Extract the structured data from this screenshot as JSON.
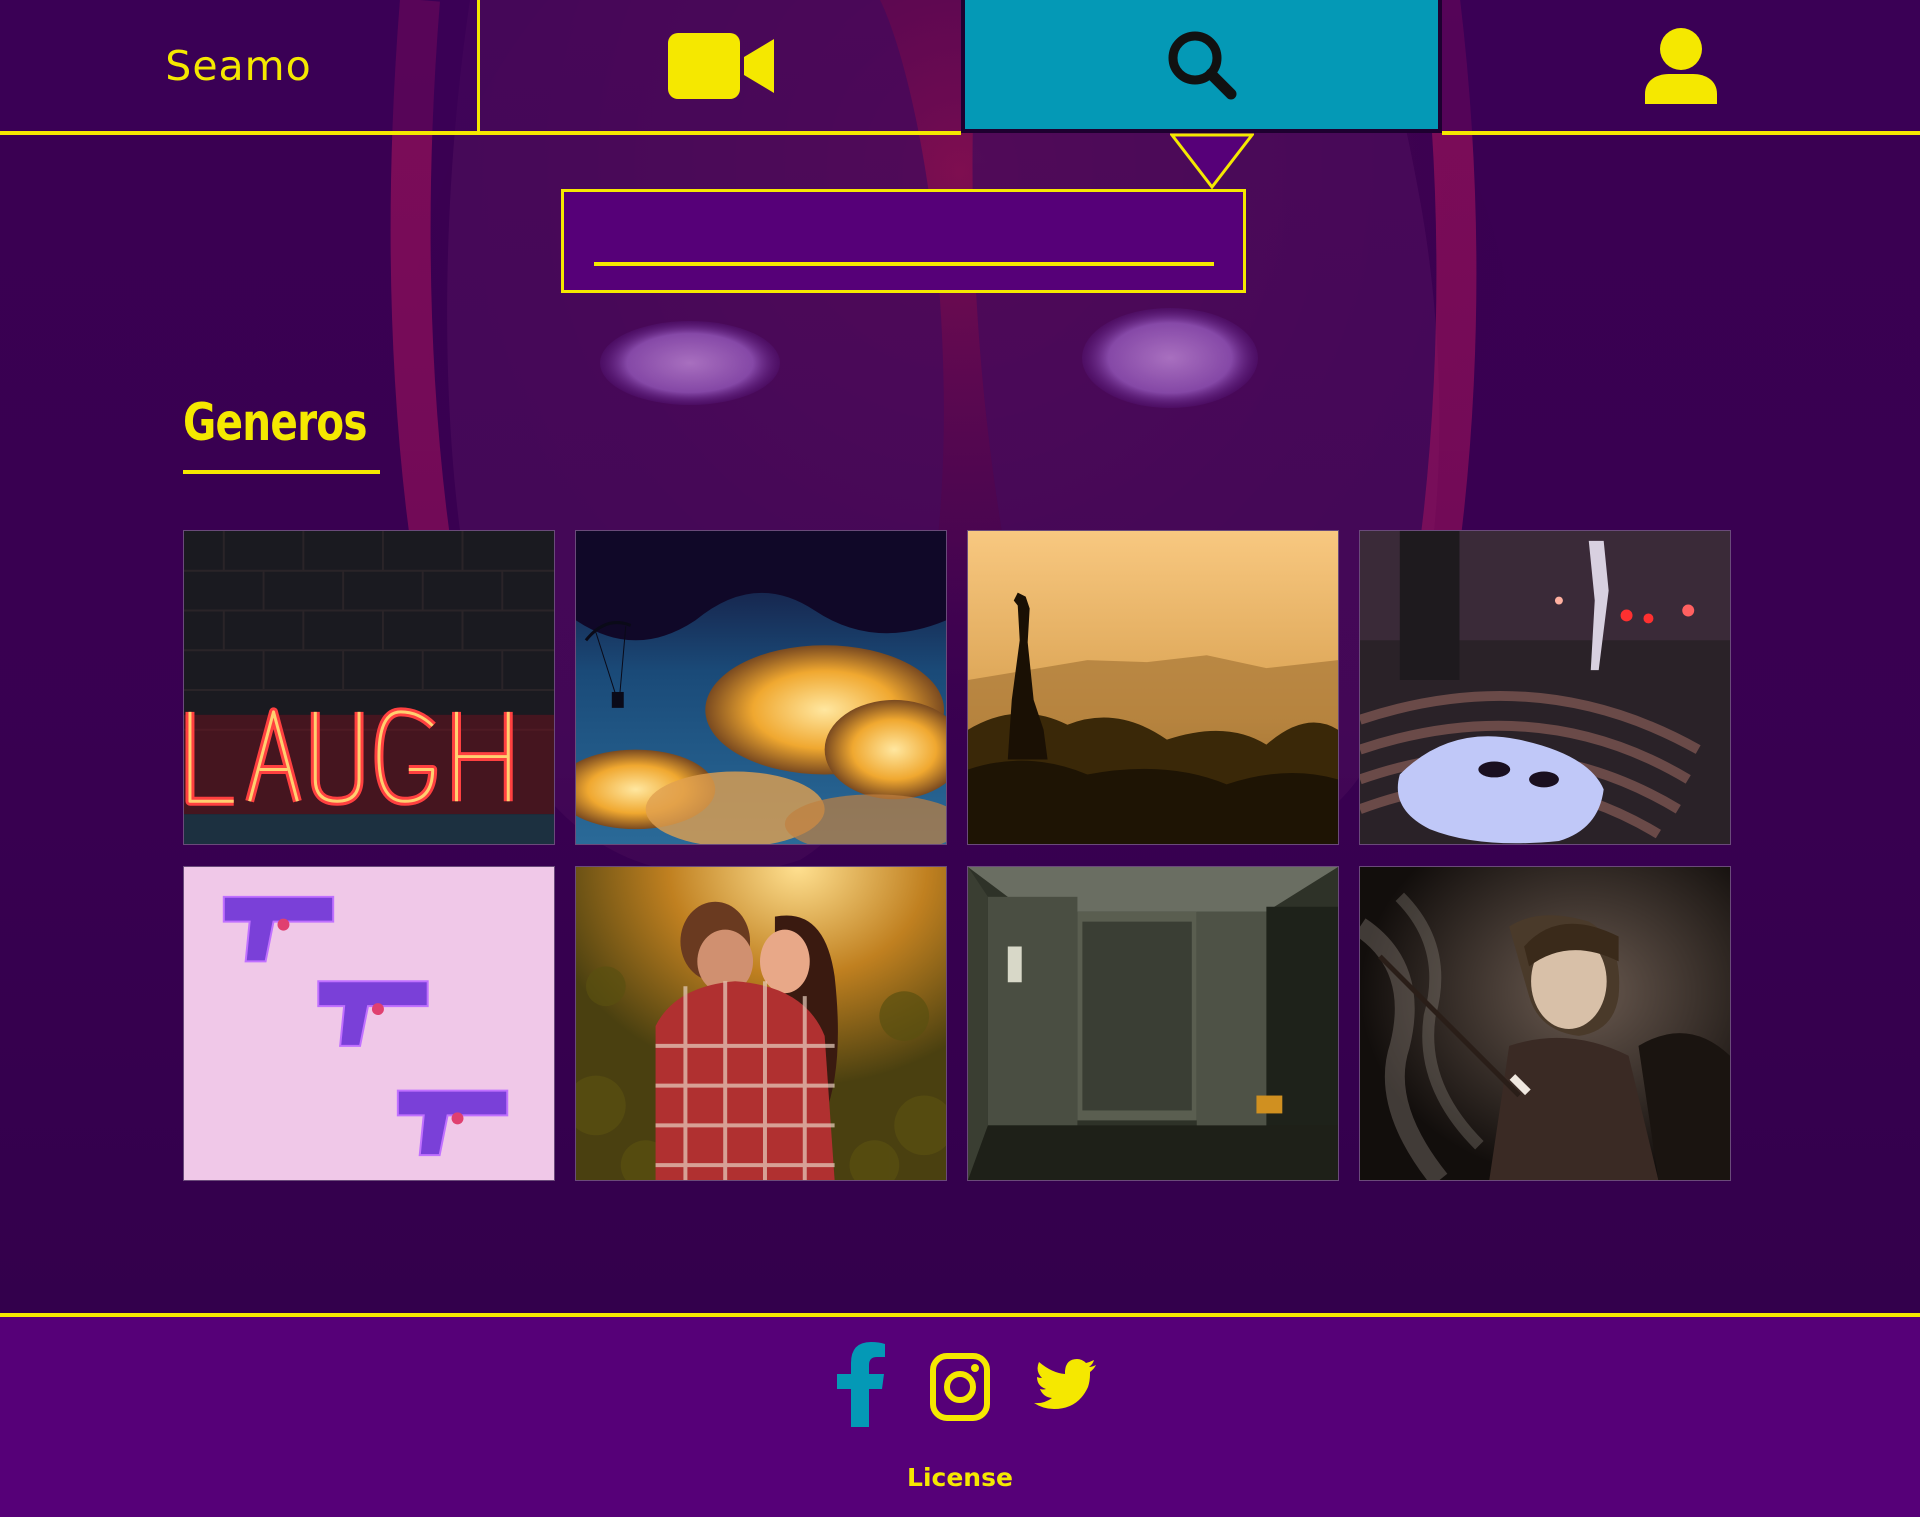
{
  "brand": {
    "name": "Seamo"
  },
  "nav": {
    "items": [
      {
        "icon": "video-camera-icon"
      },
      {
        "icon": "search-icon",
        "active": true
      },
      {
        "icon": "user-icon"
      }
    ]
  },
  "search": {
    "value": "",
    "placeholder": ""
  },
  "section": {
    "title": "Generos"
  },
  "genres": [
    {
      "image": "laugh-neon-sign"
    },
    {
      "image": "parachutist-clouds"
    },
    {
      "image": "giraffe-sunset"
    },
    {
      "image": "mask-street-night"
    },
    {
      "image": "water-pistols-pink"
    },
    {
      "image": "couple-embrace-field"
    },
    {
      "image": "abandoned-elevator"
    },
    {
      "image": "noir-woman-smoke"
    }
  ],
  "footer": {
    "social": [
      "facebook-icon",
      "instagram-icon",
      "twitter-icon"
    ],
    "license_label": "License"
  },
  "colors": {
    "accent": "#f5e800",
    "background": "#33004c",
    "panel": "#560078",
    "active_tab": "#0499b6",
    "facebook": "#0499b6"
  }
}
